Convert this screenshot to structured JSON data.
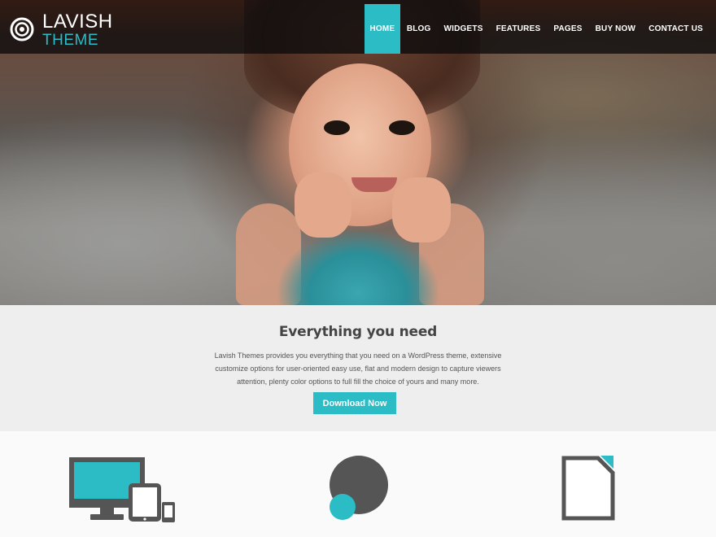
{
  "brand": {
    "line1": "LAVISH",
    "line2": "THEME",
    "icon": "target-icon"
  },
  "nav": {
    "items": [
      {
        "label": "HOME",
        "active": true
      },
      {
        "label": "BLOG"
      },
      {
        "label": "WIDGETS"
      },
      {
        "label": "FEATURES"
      },
      {
        "label": "PAGES"
      },
      {
        "label": "BUY NOW"
      },
      {
        "label": "CONTACT US"
      }
    ]
  },
  "intro": {
    "title": "Everything you need",
    "text": "Lavish Themes provides you everything that you need on a WordPress theme, extensive customize options for user-oriented easy use, flat and modern design to capture viewers attention, plenty color options to full fill the choice of yours and many more.",
    "button": "Download Now"
  },
  "features": [
    {
      "icon": "responsive-devices-icon"
    },
    {
      "icon": "color-circles-icon"
    },
    {
      "icon": "document-icon"
    }
  ],
  "colors": {
    "accent": "#2bbcc6",
    "icon_gray": "#555555",
    "strip_bg": "#eeeeee"
  }
}
